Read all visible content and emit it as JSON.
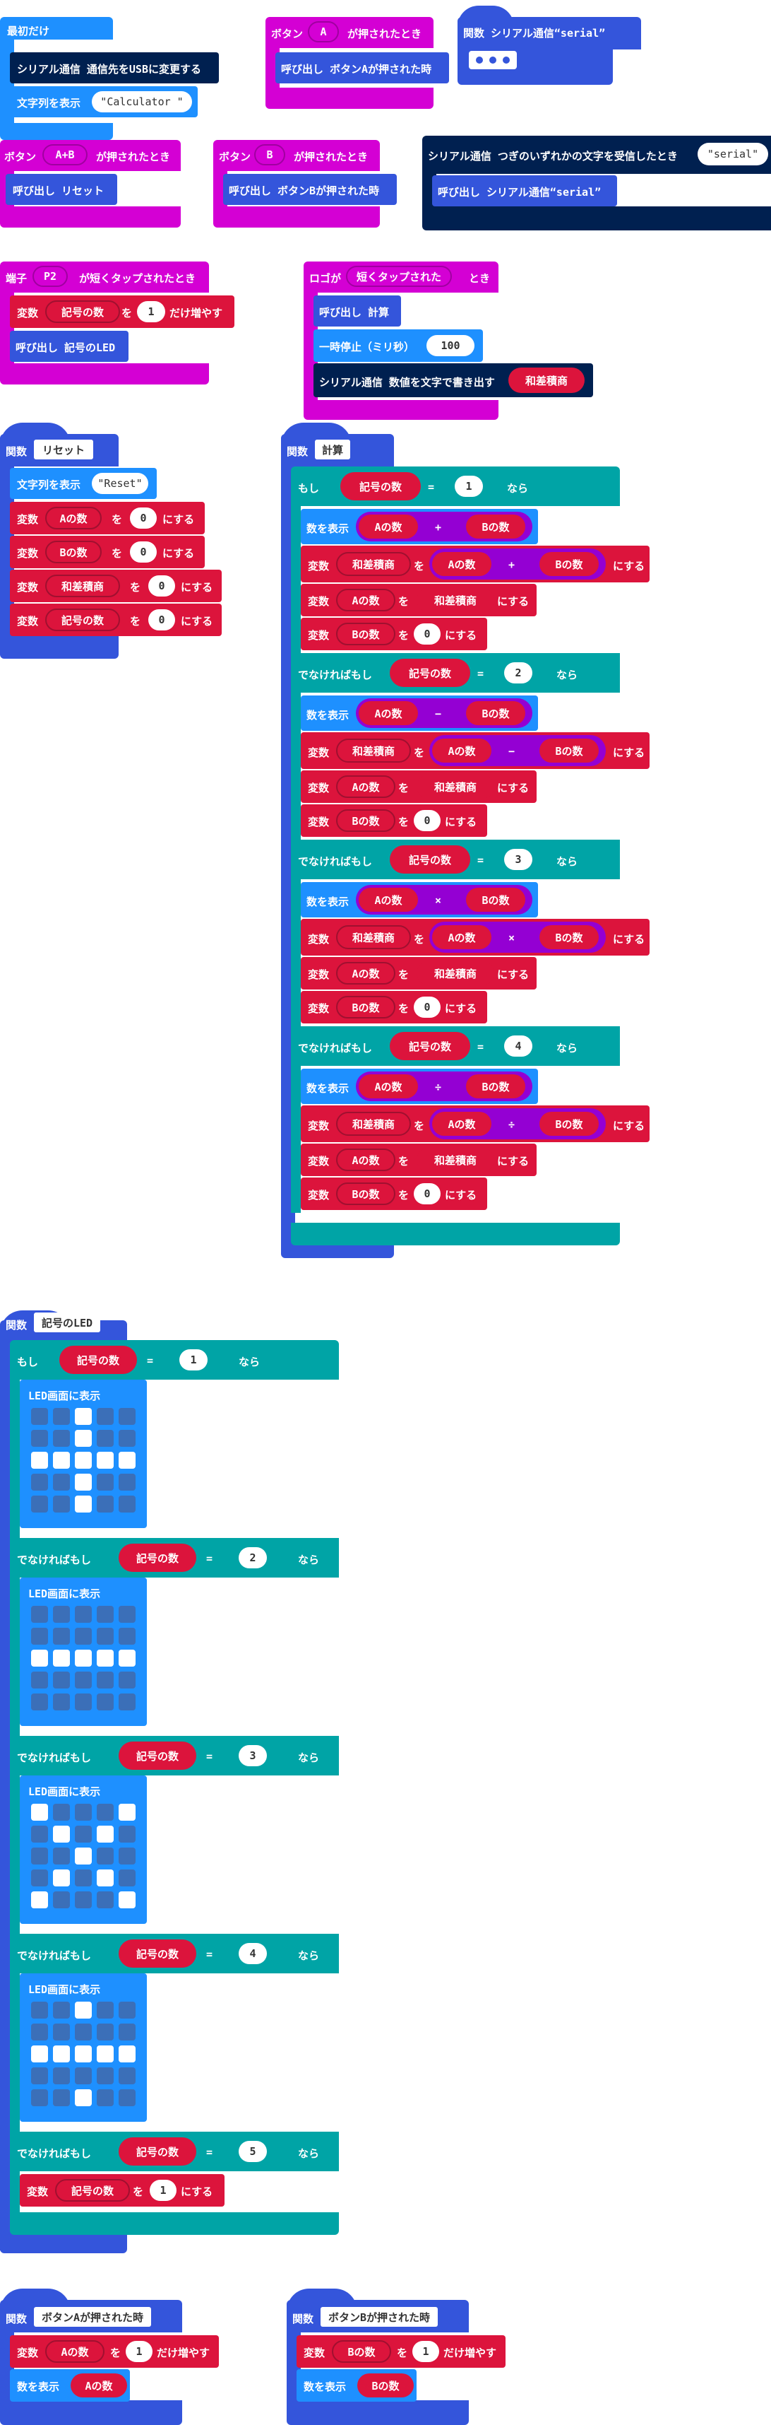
{
  "colors": {
    "basic": "#1e90ff",
    "function": "#3455db",
    "input": "#d400d4",
    "serial": "#002050",
    "variable": "#dc143c",
    "logic": "#00a4a6",
    "math": "#9400d3",
    "control": "#4c97ff"
  },
  "on_start": {
    "title": "最初だけ",
    "serial_redirect": "シリアル通信 通信先をUSBに変更する",
    "show_string_label": "文字列を表示",
    "show_string_value": "\"Calculator \""
  },
  "button_a": {
    "title_prefix": "ボタン",
    "button": "A",
    "title_suffix": "が押されたとき",
    "call": "呼び出し ボタンAが押された時"
  },
  "func_serial_collapsed": {
    "label": "関数 シリアル通信“serial”"
  },
  "button_ab": {
    "title_prefix": "ボタン",
    "button": "A+B",
    "title_suffix": "が押されたとき",
    "call": "呼び出し リセット"
  },
  "button_b": {
    "title_prefix": "ボタン",
    "button": "B",
    "title_suffix": "が押されたとき",
    "call": "呼び出し ボタンBが押された時"
  },
  "serial_receive": {
    "title": "シリアル通信 つぎのいずれかの文字を受信したとき",
    "value": "\"serial\"",
    "call": "呼び出し シリアル通信“serial”"
  },
  "pin_p2": {
    "title_prefix": "端子",
    "pin": "P2",
    "title_suffix": "が短くタップされたとき",
    "change_label": "変数",
    "var": "記号の数",
    "by": "を",
    "amount": "1",
    "change_suffix": "だけ増やす",
    "call": "呼び出し 記号のLED"
  },
  "logo_tap": {
    "title_prefix": "ロゴが",
    "action": "短くタップされた",
    "title_suffix": "とき",
    "call": "呼び出し 計算",
    "pause_label": "一時停止（ミリ秒）",
    "pause_value": "100",
    "serial_write": "シリアル通信 数値を文字で書き出す",
    "serial_var": "和差積商"
  },
  "func_reset": {
    "label": "関数",
    "name": "リセット",
    "show_string_label": "文字列を表示",
    "show_string_value": "\"Reset\"",
    "set_rows": [
      {
        "prefix": "変数",
        "var": "Aの数",
        "wo": "を",
        "value": "0",
        "suffix": "にする"
      },
      {
        "prefix": "変数",
        "var": "Bの数",
        "wo": "を",
        "value": "0",
        "suffix": "にする"
      },
      {
        "prefix": "変数",
        "var": "和差積商",
        "wo": "を",
        "value": "0",
        "suffix": "にする"
      },
      {
        "prefix": "変数",
        "var": "記号の数",
        "wo": "を",
        "value": "0",
        "suffix": "にする"
      }
    ]
  },
  "func_calc": {
    "label": "関数",
    "name": "計算",
    "if_label": "もし",
    "elseif_label": "でなければもし",
    "then_label": "なら",
    "var_label": "変数",
    "cond_var": "記号の数",
    "eq": "=",
    "show_number_label": "数を表示",
    "wo": "を",
    "set_suffix": "にする",
    "result_var": "和差積商",
    "var_a": "Aの数",
    "var_b": "Bの数",
    "zero": "0",
    "branches": [
      {
        "num": "1",
        "op": "+"
      },
      {
        "num": "2",
        "op": "−"
      },
      {
        "num": "3",
        "op": "×"
      },
      {
        "num": "4",
        "op": "÷"
      }
    ]
  },
  "func_led": {
    "label": "関数",
    "name": "記号のLED",
    "if_label": "もし",
    "elseif_label": "でなければもし",
    "then_label": "なら",
    "cond_var": "記号の数",
    "eq": "=",
    "show_leds_label": "LED画面に表示",
    "branches": [
      {
        "num": "1",
        "leds": [
          [
            0,
            0,
            1,
            0,
            0
          ],
          [
            0,
            0,
            1,
            0,
            0
          ],
          [
            1,
            1,
            1,
            1,
            1
          ],
          [
            0,
            0,
            1,
            0,
            0
          ],
          [
            0,
            0,
            1,
            0,
            0
          ]
        ]
      },
      {
        "num": "2",
        "leds": [
          [
            0,
            0,
            0,
            0,
            0
          ],
          [
            0,
            0,
            0,
            0,
            0
          ],
          [
            1,
            1,
            1,
            1,
            1
          ],
          [
            0,
            0,
            0,
            0,
            0
          ],
          [
            0,
            0,
            0,
            0,
            0
          ]
        ]
      },
      {
        "num": "3",
        "leds": [
          [
            1,
            0,
            0,
            0,
            1
          ],
          [
            0,
            1,
            0,
            1,
            0
          ],
          [
            0,
            0,
            1,
            0,
            0
          ],
          [
            0,
            1,
            0,
            1,
            0
          ],
          [
            1,
            0,
            0,
            0,
            1
          ]
        ]
      },
      {
        "num": "4",
        "leds": [
          [
            0,
            0,
            1,
            0,
            0
          ],
          [
            0,
            0,
            0,
            0,
            0
          ],
          [
            1,
            1,
            1,
            1,
            1
          ],
          [
            0,
            0,
            0,
            0,
            0
          ],
          [
            0,
            0,
            1,
            0,
            0
          ]
        ]
      }
    ],
    "last_num": "5",
    "set_label": "変数",
    "set_var": "記号の数",
    "set_wo": "を",
    "set_value": "1",
    "set_suffix": "にする"
  },
  "func_button_a": {
    "label": "関数",
    "name": "ボタンAが押された時",
    "change_label": "変数",
    "var": "Aの数",
    "by": "を",
    "amount": "1",
    "change_suffix": "だけ増やす",
    "show_number_label": "数を表示",
    "show_var": "Aの数"
  },
  "func_button_b": {
    "label": "関数",
    "name": "ボタンBが押された時",
    "change_label": "変数",
    "var": "Bの数",
    "by": "を",
    "amount": "1",
    "change_suffix": "だけ増やす",
    "show_number_label": "数を表示",
    "show_var": "Bの数"
  }
}
